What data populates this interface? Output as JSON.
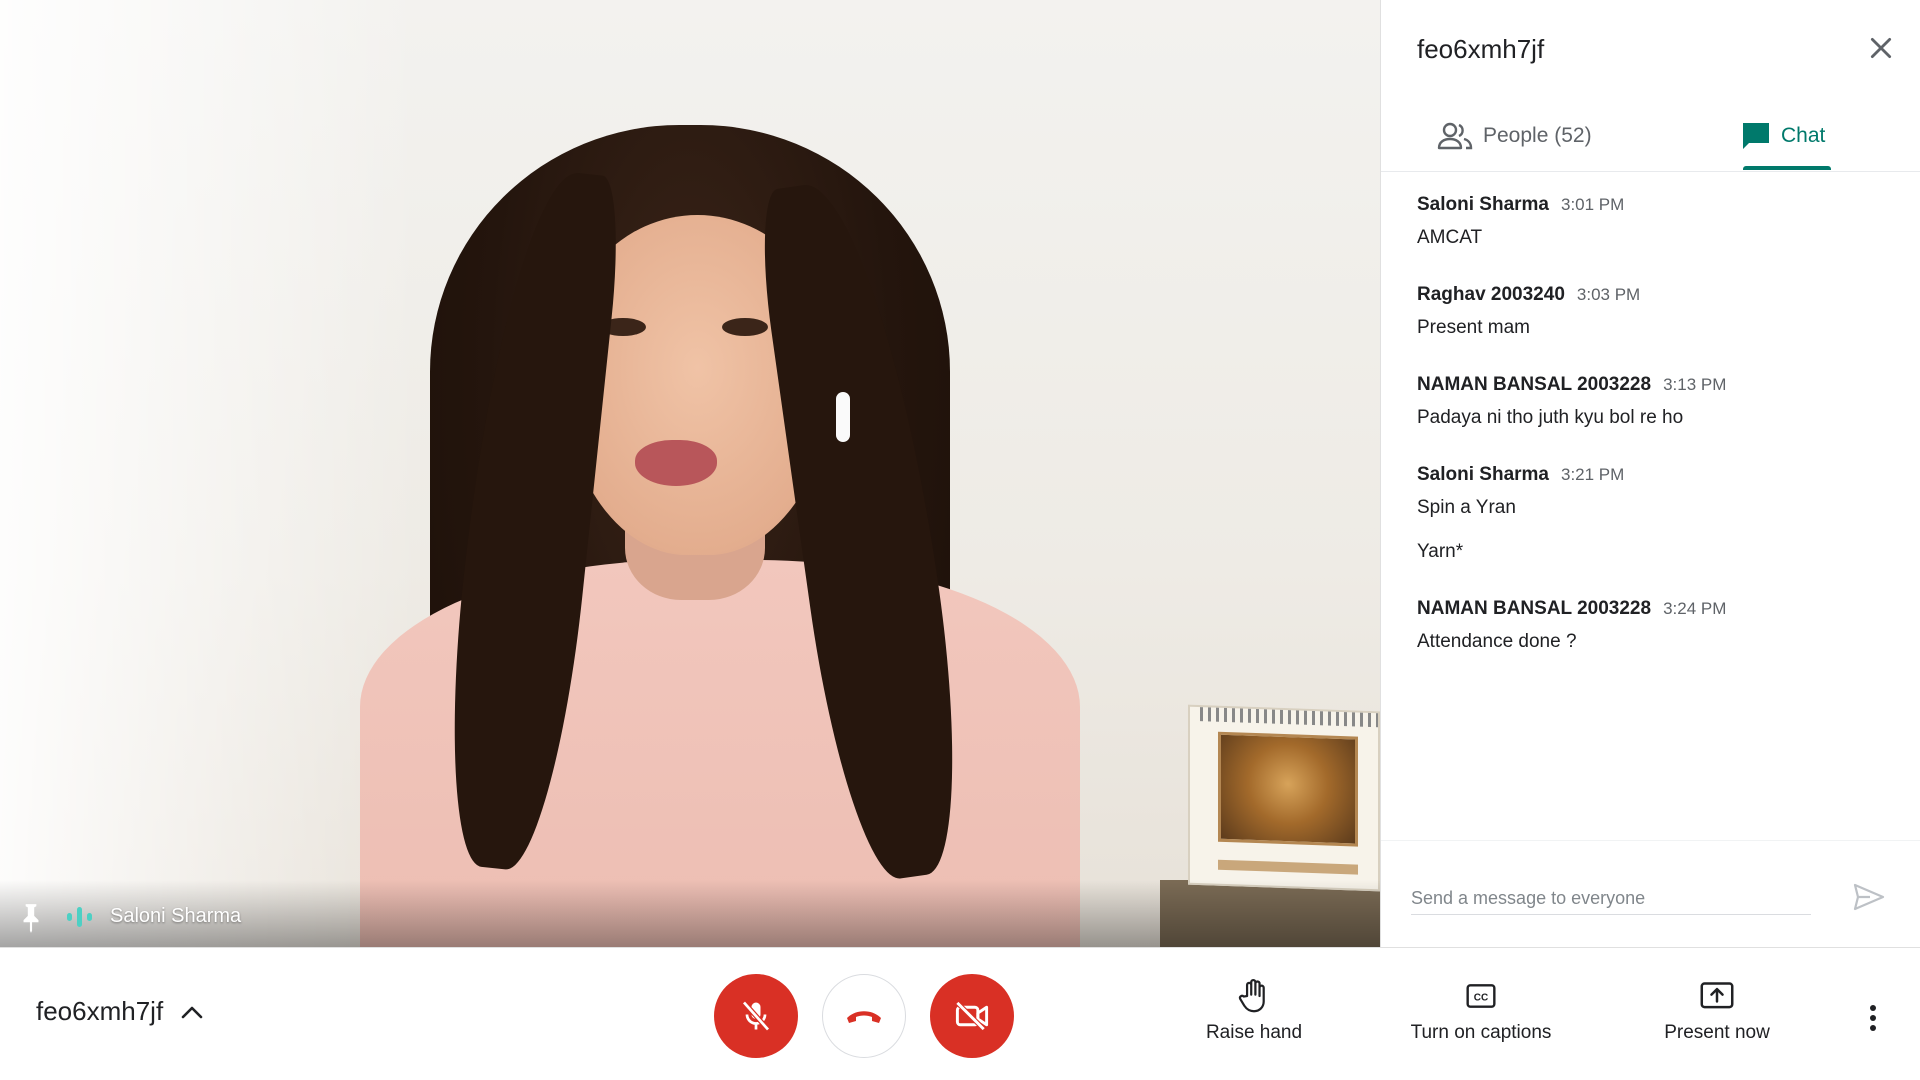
{
  "meeting": {
    "code": "feo6xmh7jf"
  },
  "stage": {
    "participant_name": "Saloni Sharma"
  },
  "panel": {
    "title": "feo6xmh7jf",
    "tabs": {
      "people_label": "People (52)",
      "chat_label": "Chat",
      "active": "Chat"
    },
    "messages": [
      {
        "sender": "Saloni Sharma",
        "time": "3:01 PM",
        "lines": [
          "AMCAT"
        ]
      },
      {
        "sender": "Raghav 2003240",
        "time": "3:03 PM",
        "lines": [
          "Present mam"
        ]
      },
      {
        "sender": "NAMAN BANSAL 2003228",
        "time": "3:13 PM",
        "lines": [
          "Padaya ni tho juth kyu bol re ho"
        ]
      },
      {
        "sender": "Saloni Sharma",
        "time": "3:21 PM",
        "lines": [
          "Spin a Yran",
          "Yarn*"
        ]
      },
      {
        "sender": "NAMAN BANSAL 2003228",
        "time": "3:24 PM",
        "lines": [
          "Attendance done ?"
        ]
      }
    ],
    "composer": {
      "placeholder": "Send a message to everyone",
      "value": ""
    }
  },
  "controls": {
    "raise_hand_label": "Raise hand",
    "captions_label": "Turn on captions",
    "present_label": "Present now",
    "mic_state": "muted",
    "camera_state": "off"
  },
  "colors": {
    "accent_teal": "#00796b",
    "danger_red": "#d93025",
    "text_primary": "#202124",
    "text_secondary": "#5f6368"
  },
  "icons": {
    "pin": "pin-icon",
    "audio": "audio-level-icon",
    "close": "close-icon",
    "people": "people-icon",
    "chat": "chat-icon",
    "send": "send-icon",
    "chevron": "chevron-up-icon",
    "mic_off": "mic-off-icon",
    "hang_up": "phone-hangup-icon",
    "cam_off": "videocam-off-icon",
    "raise_hand": "hand-icon",
    "captions": "closed-captions-icon",
    "present": "present-screen-icon",
    "more": "more-vert-icon"
  }
}
